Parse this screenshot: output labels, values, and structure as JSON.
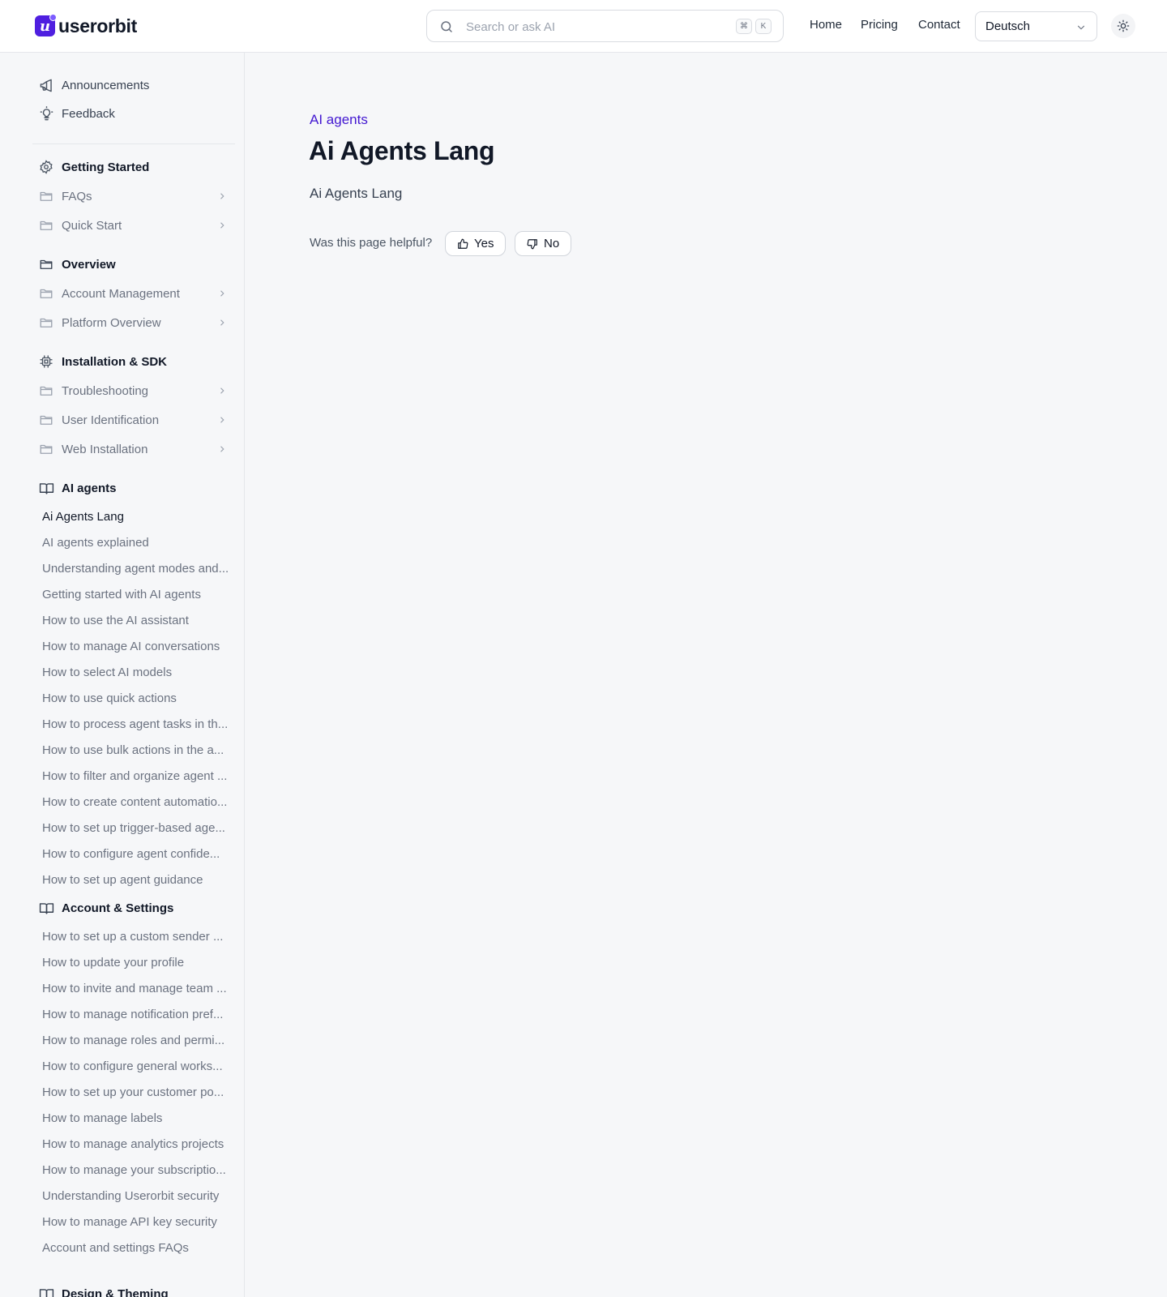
{
  "brand": {
    "name": "userorbit",
    "mark": "u"
  },
  "header": {
    "search": {
      "placeholder": "Search or ask AI",
      "value": "",
      "kbd_1": "⌘",
      "kbd_2": "K"
    },
    "nav": [
      {
        "label": "Home"
      },
      {
        "label": "Pricing"
      },
      {
        "label": "Contact"
      }
    ],
    "language": {
      "selected": "Deutsch"
    }
  },
  "sidebar": {
    "top_links": [
      {
        "label": "Announcements",
        "icon": "megaphone-icon"
      },
      {
        "label": "Feedback",
        "icon": "lightbulb-icon"
      }
    ],
    "sections": [
      {
        "label": "Getting Started",
        "icon": "gear-icon",
        "folders": [
          "FAQs",
          "Quick Start"
        ]
      },
      {
        "label": "Overview",
        "icon": "folder-icon",
        "folders": [
          "Account Management",
          "Platform Overview"
        ]
      },
      {
        "label": "Installation & SDK",
        "icon": "chip-icon",
        "folders": [
          "Troubleshooting",
          "User Identification",
          "Web Installation"
        ]
      },
      {
        "label": "AI agents",
        "icon": "book-icon",
        "articles": [
          "Ai Agents Lang",
          "AI agents explained",
          "Understanding agent modes and...",
          "Getting started with AI agents",
          "How to use the AI assistant",
          "How to manage AI conversations",
          "How to select AI models",
          "How to use quick actions",
          "How to process agent tasks in th...",
          "How to use bulk actions in the a...",
          "How to filter and organize agent ...",
          "How to create content automatio...",
          "How to set up trigger-based age...",
          "How to configure agent confide...",
          "How to set up agent guidance"
        ]
      },
      {
        "label": "Account & Settings",
        "icon": "book-icon",
        "articles": [
          "How to set up a custom sender ...",
          "How to update your profile",
          "How to invite and manage team ...",
          "How to manage notification pref...",
          "How to manage roles and permi...",
          "How to configure general works...",
          "How to set up your customer po...",
          "How to manage labels",
          "How to manage analytics projects",
          "How to manage your subscriptio...",
          "Understanding Userorbit security",
          "How to manage API key security",
          "Account and settings FAQs"
        ]
      },
      {
        "label": "Design & Theming",
        "icon": "book-icon"
      }
    ]
  },
  "main": {
    "breadcrumb": "AI agents",
    "title": "Ai Agents Lang",
    "description": "Ai Agents Lang",
    "feedback": {
      "question": "Was this page helpful?",
      "yes": "Yes",
      "no": "No"
    }
  },
  "colors": {
    "accent": "#4318d1",
    "brand": "#4f1fe0",
    "background": "#f6f7f9"
  }
}
